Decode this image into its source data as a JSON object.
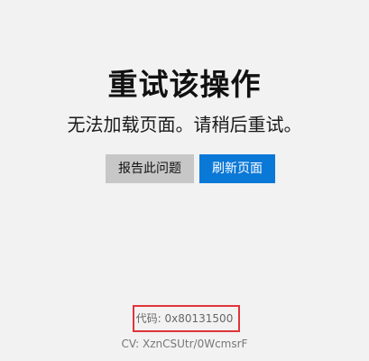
{
  "error": {
    "title": "重试该操作",
    "message": "无法加载页面。请稍后重试。",
    "report_button_label": "报告此问题",
    "refresh_button_label": "刷新页面",
    "code_text": "代码: 0x80131500",
    "cv_text": "CV: XznCSUtr/0WcmsrF"
  },
  "colors": {
    "background": "#f2f2f2",
    "refresh_button": "#0a78d7",
    "report_button": "#c7c7c7",
    "highlight_box": "#e0343a"
  }
}
